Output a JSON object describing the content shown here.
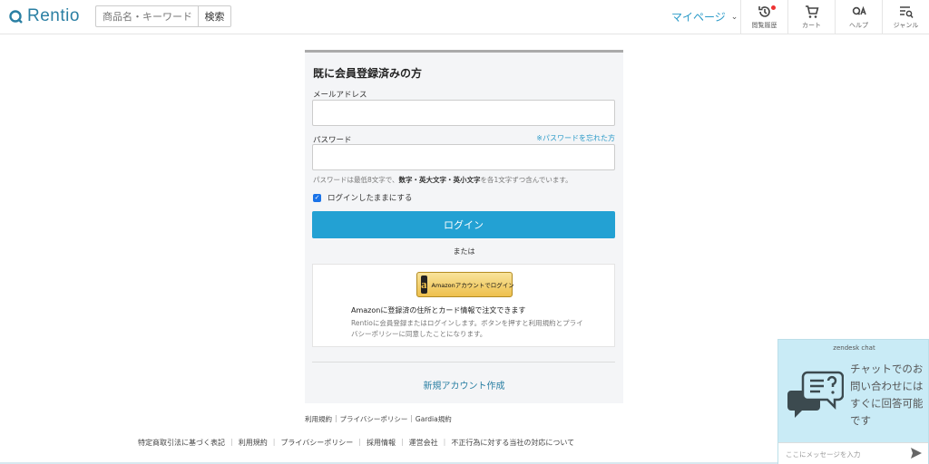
{
  "header": {
    "logo_text": "Rentio",
    "search_placeholder": "商品名・キーワード",
    "search_button": "検索",
    "mypage": "マイページ",
    "nav": [
      {
        "label": "閲覧履歴",
        "icon": "history-icon"
      },
      {
        "label": "カート",
        "icon": "cart-icon"
      },
      {
        "label": "ヘルプ",
        "icon": "qa-icon"
      },
      {
        "label": "ジャンル",
        "icon": "genre-search-icon"
      }
    ]
  },
  "login": {
    "title": "既に会員登録済みの方",
    "email_label": "メールアドレス",
    "password_label": "パスワード",
    "forgot": "※パスワードを忘れた方",
    "hint_prefix": "パスワードは最低8文字で、",
    "hint_bold": "数字・英大文字・英小文字",
    "hint_suffix": "を各1文字ずつ含んでいます。",
    "remember": "ログインしたままにする",
    "login_button": "ログイン",
    "or": "または",
    "amazon_button": "Amazonアカウントでログイン",
    "amazon_note": "Amazonに登録済の住所とカード情報で注文できます",
    "amazon_terms": "Rentioに会員登録またはログインします。ボタンを押すと利用規約とプライバシーポリシーに同意したことになります。",
    "new_account": "新規アカウント作成"
  },
  "mini_links": [
    "利用規約",
    "プライバシーポリシー",
    "Gardia規約"
  ],
  "footer_links": [
    "特定商取引法に基づく表記",
    "利用規約",
    "プライバシーポリシー",
    "採用情報",
    "運営会社",
    "不正行為に対する当社の対応について"
  ],
  "chat": {
    "title": "zendesk chat",
    "message": "チャットでのお問い合わせにはすぐに回答可能です",
    "input_placeholder": "ここにメッセージを入力"
  },
  "colors": {
    "accent": "#23a1d3",
    "link": "#2a9ac8",
    "chat_bg": "#c9ebf6"
  }
}
